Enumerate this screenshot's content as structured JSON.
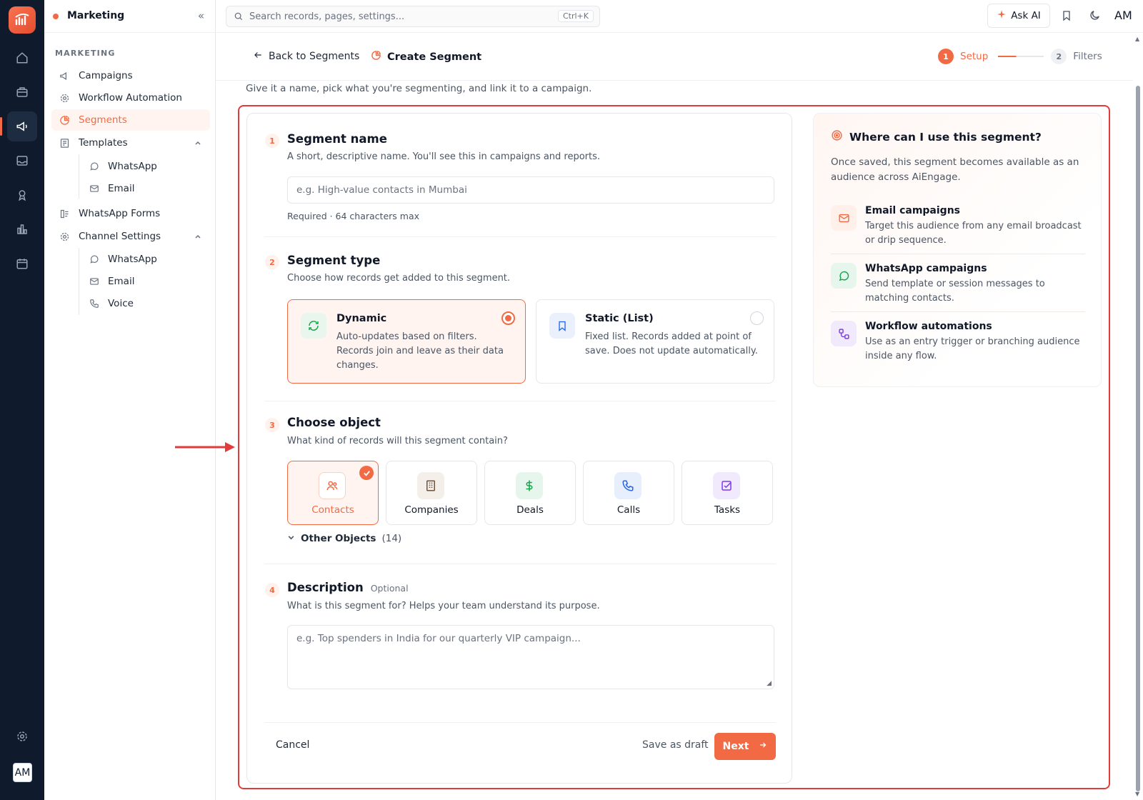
{
  "app": {
    "workspace": "Marketing",
    "user_initials": "AM"
  },
  "sidebar": {
    "section_label": "MARKETING",
    "items": [
      {
        "label": "Campaigns",
        "icon": "megaphone-icon"
      },
      {
        "label": "Workflow Automation",
        "icon": "workflow-icon"
      },
      {
        "label": "Segments",
        "icon": "pie-chart-icon",
        "active": true
      },
      {
        "label": "Templates",
        "icon": "template-icon"
      },
      {
        "label": "WhatsApp Forms",
        "icon": "form-icon"
      },
      {
        "label": "Channel Settings",
        "icon": "gear-icon"
      }
    ],
    "templates_children": [
      {
        "label": "WhatsApp",
        "icon": "whatsapp-icon"
      },
      {
        "label": "Email",
        "icon": "mail-icon"
      }
    ],
    "channel_children": [
      {
        "label": "WhatsApp",
        "icon": "whatsapp-icon"
      },
      {
        "label": "Email",
        "icon": "mail-icon"
      },
      {
        "label": "Voice",
        "icon": "phone-icon"
      }
    ]
  },
  "topbar": {
    "search_placeholder": "Search records, pages, settings...",
    "search_shortcut": "Ctrl+K",
    "ask_ai": "Ask AI"
  },
  "header": {
    "back_label": "Back to Segments",
    "title": "Create Segment",
    "steps": [
      {
        "num": "1",
        "label": "Setup",
        "active": true
      },
      {
        "num": "2",
        "label": "Filters",
        "active": false
      }
    ],
    "intro": "Give it a name, pick what you're segmenting, and link it to a campaign."
  },
  "form": {
    "name": {
      "num": "1",
      "title": "Segment name",
      "desc": "A short, descriptive name. You'll see this in campaigns and reports.",
      "placeholder": "e.g. High-value contacts in Mumbai",
      "hint": "Required · 64 characters max"
    },
    "type": {
      "num": "2",
      "title": "Segment type",
      "desc": "Choose how records get added to this segment.",
      "options": [
        {
          "title": "Dynamic",
          "desc": "Auto-updates based on filters. Records join and leave as their data changes.",
          "selected": true
        },
        {
          "title": "Static (List)",
          "desc": "Fixed list. Records added at point of save. Does not update automatically.",
          "selected": false
        }
      ]
    },
    "object": {
      "num": "3",
      "title": "Choose object",
      "desc": "What kind of records will this segment contain?",
      "options": [
        {
          "label": "Contacts",
          "selected": true
        },
        {
          "label": "Companies",
          "selected": false
        },
        {
          "label": "Deals",
          "selected": false
        },
        {
          "label": "Calls",
          "selected": false
        },
        {
          "label": "Tasks",
          "selected": false
        }
      ],
      "other_label": "Other Objects",
      "other_count": "(14)"
    },
    "description": {
      "num": "4",
      "title": "Description",
      "optional": "Optional",
      "desc": "What is this segment for? Helps your team understand its purpose.",
      "placeholder": "e.g. Top spenders in India for our quarterly VIP campaign..."
    },
    "actions": {
      "cancel": "Cancel",
      "draft": "Save as draft",
      "next": "Next"
    }
  },
  "info": {
    "title": "Where can I use this segment?",
    "desc": "Once saved, this segment becomes available as an audience across AiEngage.",
    "uses": [
      {
        "title": "Email campaigns",
        "desc": "Target this audience from any email broadcast or drip sequence.",
        "icon": "mail-icon"
      },
      {
        "title": "WhatsApp campaigns",
        "desc": "Send template or session messages to matching contacts.",
        "icon": "chat-bubble-icon"
      },
      {
        "title": "Workflow automations",
        "desc": "Use as an entry trigger or branching audience inside any flow.",
        "icon": "workflow-icon"
      }
    ]
  },
  "colors": {
    "accent": "#f26a44",
    "rail": "#0f1b2d",
    "highlight": "#e23b3b"
  }
}
